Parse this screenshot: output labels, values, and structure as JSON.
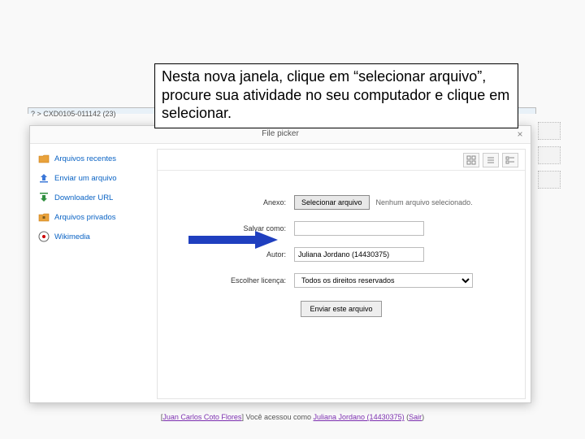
{
  "breadcrumb": "? > CXD0105-011142 (23)",
  "callout": "Nesta nova janela, clique em “selecionar arquivo”, procure sua atividade no seu computador e clique em selecionar.",
  "modal": {
    "title": "File picker",
    "close": "×"
  },
  "sidebar": {
    "items": [
      {
        "icon": "folder-recent-icon",
        "label": "Arquivos recentes"
      },
      {
        "icon": "upload-icon",
        "label": "Enviar um arquivo"
      },
      {
        "icon": "download-icon",
        "label": "Downloader URL"
      },
      {
        "icon": "folder-private-icon",
        "label": "Arquivos privados"
      },
      {
        "icon": "wiki-icon",
        "label": "Wikimedia"
      }
    ]
  },
  "form": {
    "anexo_label": "Anexo:",
    "browse_label": "Selecionar arquivo",
    "no_file": "Nenhum arquivo selecionado.",
    "salvar_como_label": "Salvar como:",
    "autor_label": "Autor:",
    "autor_value": "Juliana Jordano (14430375)",
    "licenca_label": "Escolher licença:",
    "licenca_value": "Todos os direitos reservados",
    "submit_label": "Enviar este arquivo"
  },
  "footer": {
    "left_link": "Juan Carlos Coto Flores",
    "middle": "Você acessou como ",
    "user": "Juliana Jordano (14430375)",
    "logout": "Sair"
  }
}
